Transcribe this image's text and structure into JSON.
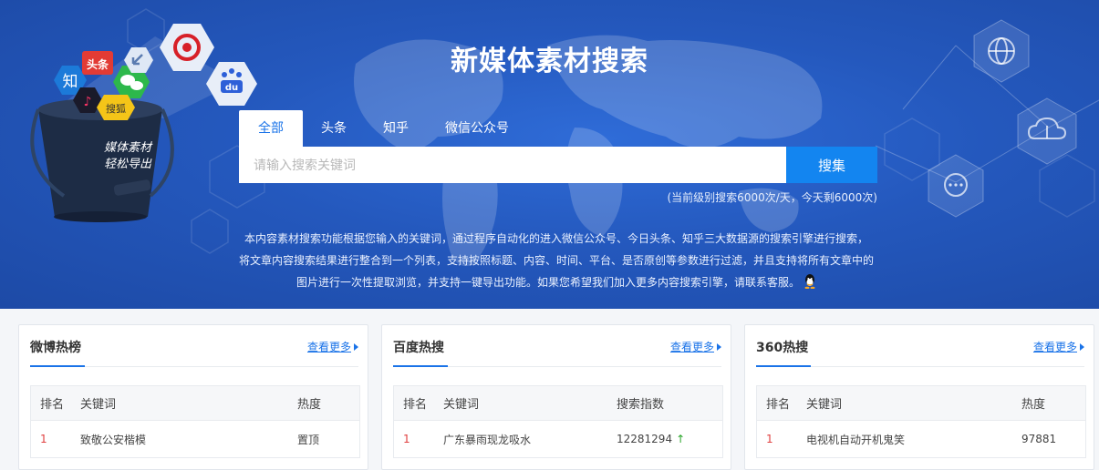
{
  "banner": {
    "title": "新媒体素材搜索",
    "bucket_line1": "媒体素材",
    "bucket_line2": "轻松导出",
    "icon_zhihu": "知",
    "icon_toutiao": "头条",
    "icon_sohu": "搜狐",
    "icon_baidu": "du",
    "tabs": [
      {
        "label": "全部",
        "active": true
      },
      {
        "label": "头条",
        "active": false
      },
      {
        "label": "知乎",
        "active": false
      },
      {
        "label": "微信公众号",
        "active": false
      }
    ],
    "search_placeholder": "请输入搜索关键词",
    "search_button": "搜集",
    "quota": "(当前级别搜索6000次/天，今天剩6000次)",
    "description": [
      "本内容素材搜索功能根据您输入的关键词，通过程序自动化的进入微信公众号、今日头条、知乎三大数据源的搜索引擎进行搜索，",
      "将文章内容搜索结果进行整合到一个列表，支持按照标题、内容、时间、平台、是否原创等参数进行过滤，并且支持将所有文章中的",
      "图片进行一次性提取浏览，并支持一键导出功能。如果您希望我们加入更多内容搜索引擎，请联系客服。"
    ]
  },
  "panels": [
    {
      "title": "微博热榜",
      "more": "查看更多",
      "headers": [
        "排名",
        "关键词",
        "热度"
      ],
      "rows": [
        {
          "rank": "1",
          "keyword": "致敬公安楷模",
          "heat": "置顶"
        }
      ]
    },
    {
      "title": "百度热搜",
      "more": "查看更多",
      "headers": [
        "排名",
        "关键词",
        "搜索指数"
      ],
      "rows": [
        {
          "rank": "1",
          "keyword": "广东暴雨现龙吸水",
          "heat": "12281294",
          "trend": "↑"
        }
      ]
    },
    {
      "title": "360热搜",
      "more": "查看更多",
      "headers": [
        "排名",
        "关键词",
        "热度"
      ],
      "rows": [
        {
          "rank": "1",
          "keyword": "电视机自动开机鬼笑",
          "heat": "97881"
        }
      ]
    }
  ],
  "colors": {
    "banner_blue": "#2458bd",
    "accent": "#1a73e8",
    "search_button": "#1385f0",
    "rank_red": "#e04040",
    "trend_green": "#2aa52a"
  }
}
